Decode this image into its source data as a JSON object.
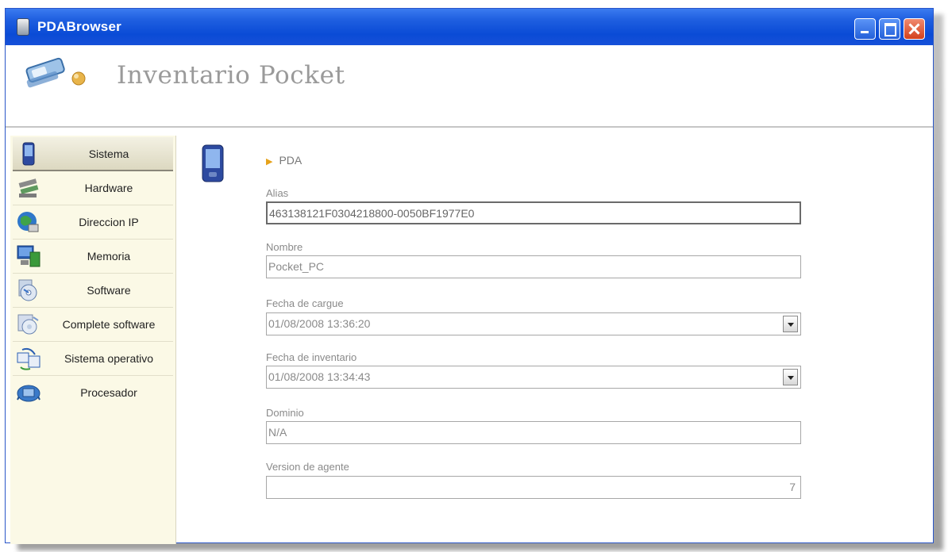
{
  "window": {
    "title": "PDABrowser"
  },
  "header": {
    "app_title": "Inventario Pocket"
  },
  "sidebar": {
    "items": [
      {
        "label": "Sistema",
        "icon": "pda-icon",
        "active": true
      },
      {
        "label": "Hardware",
        "icon": "hardware-icon"
      },
      {
        "label": "Direccion IP",
        "icon": "globe-network-icon"
      },
      {
        "label": "Memoria",
        "icon": "memory-icon"
      },
      {
        "label": "Software",
        "icon": "software-cd-icon"
      },
      {
        "label": "Complete software",
        "icon": "software-package-icon"
      },
      {
        "label": "Sistema operativo",
        "icon": "os-sync-icon"
      },
      {
        "label": "Procesador",
        "icon": "processor-icon"
      }
    ]
  },
  "main": {
    "breadcrumb": "PDA",
    "fields": {
      "alias": {
        "label": "Alias",
        "value": "463138121F0304218800-0050BF1977E0"
      },
      "nombre": {
        "label": "Nombre",
        "value": "Pocket_PC"
      },
      "fecha_cargue": {
        "label": "Fecha de cargue",
        "value": "01/08/2008 13:36:20"
      },
      "fecha_inventario": {
        "label": "Fecha de inventario",
        "value": "01/08/2008 13:34:43"
      },
      "dominio": {
        "label": "Dominio",
        "value": "N/A"
      },
      "version_agente": {
        "label": "Version de agente",
        "value": "7"
      }
    }
  },
  "colors": {
    "titlebar": "#0a4bd6",
    "sidebar_bg": "#fbf9e6",
    "breadcrumb_arrow": "#e6a21a"
  }
}
